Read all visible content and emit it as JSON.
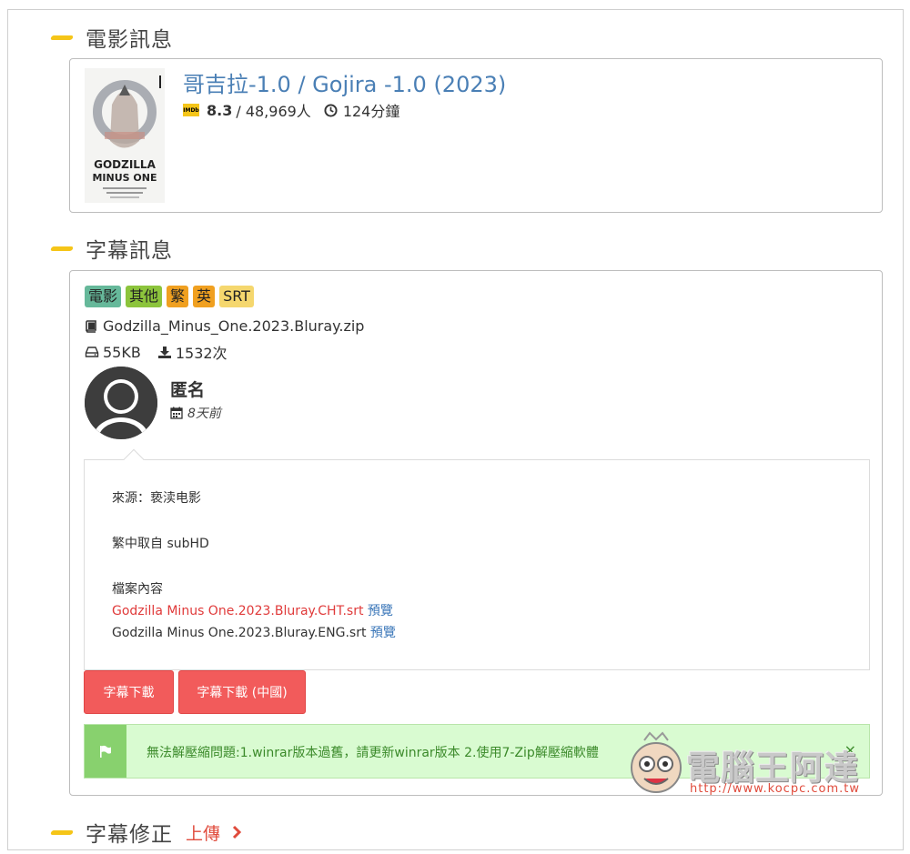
{
  "sections": {
    "movie_info": "電影訊息",
    "subtitle_info": "字幕訊息",
    "subtitle_fix": "字幕修正",
    "upload_link": "上傳"
  },
  "movie": {
    "title": "哥吉拉-1.0 / Gojira -1.0 (2023)",
    "imdb_label": "IMDb",
    "rating": "8.3",
    "votes": " / 48,969人",
    "runtime": "124分鐘",
    "poster_text_line1": "GODZILLA",
    "poster_text_line2": "MINUS ONE"
  },
  "subtitle": {
    "tags": [
      {
        "label": "電影",
        "color": "#5cb85c"
      },
      {
        "label": "其他",
        "color": "#8cc43c"
      },
      {
        "label": "繁",
        "color": "#f0a020"
      },
      {
        "label": "英",
        "color": "#f0a020"
      },
      {
        "label": "SRT",
        "color": "#f5d76e"
      }
    ],
    "filename": "Godzilla_Minus_One.2023.Bluray.zip",
    "size": "55KB",
    "downloads": "1532次",
    "uploader": "匿名",
    "time": "8天前",
    "description": {
      "source": "來源：亵渎电影",
      "from": "繁中取自 subHD",
      "contents_label": "檔案內容",
      "file1": "Godzilla Minus One.2023.Bluray.CHT.srt",
      "file2": "Godzilla Minus One.2023.Bluray.ENG.srt",
      "preview": "預覽"
    },
    "buttons": {
      "download": "字幕下載",
      "download_cn": "字幕下載 (中國)"
    },
    "alert": "無法解壓縮問題:1.winrar版本過舊，請更新winrar版本 2.使用7-Zip解壓縮軟體",
    "alert_close": "×"
  },
  "watermark": {
    "name": "電腦王阿達",
    "url": "http://www.kocpc.com.tw"
  },
  "colors": {
    "link": "#4a7fb5",
    "accent": "#f25b5b",
    "highlight": "#f5c518"
  }
}
